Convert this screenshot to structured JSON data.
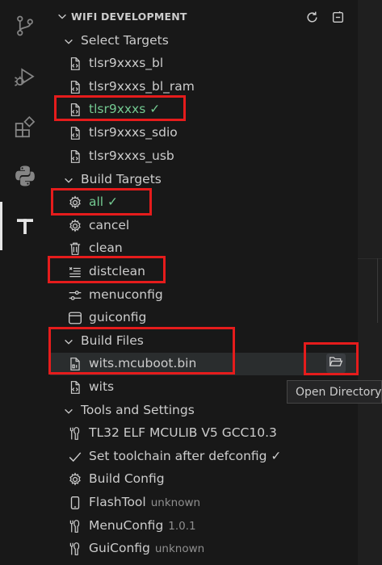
{
  "activity_bar": {
    "icons": [
      "source-control-icon",
      "run-debug-icon",
      "extensions-icon",
      "python-icon",
      "tlsr-tool-icon"
    ]
  },
  "header": {
    "title": "WIFI DEVELOPMENT",
    "actions": [
      "refresh-icon",
      "collapse-all-icon"
    ]
  },
  "tree": {
    "select_targets": {
      "label": "Select Targets",
      "items": [
        {
          "label": "tlsr9xxxs_bl"
        },
        {
          "label": "tlsr9xxxs_bl_ram"
        },
        {
          "label": "tlsr9xxxs ✓",
          "active": true
        },
        {
          "label": "tlsr9xxxs_sdio"
        },
        {
          "label": "tlsr9xxxs_usb"
        }
      ]
    },
    "build_targets": {
      "label": "Build Targets",
      "items": [
        {
          "label": "all ✓",
          "icon": "gear-icon",
          "active": true
        },
        {
          "label": "cancel",
          "icon": "gear-icon"
        },
        {
          "label": "clean",
          "icon": "trash-icon"
        },
        {
          "label": "distclean",
          "icon": "clear-all-icon"
        },
        {
          "label": "menuconfig",
          "icon": "settings-sliders-icon"
        },
        {
          "label": "guiconfig",
          "icon": "window-icon"
        }
      ]
    },
    "build_files": {
      "label": "Build Files",
      "items": [
        {
          "label": "wits.mcuboot.bin",
          "icon": "binary-file-icon"
        },
        {
          "label": "wits",
          "icon": "code-file-icon"
        }
      ]
    },
    "tools": {
      "label": "Tools and Settings",
      "items": [
        {
          "label": "TL32 ELF MCULIB V5 GCC10.3",
          "icon": "tools-icon",
          "desc": ""
        },
        {
          "label": "Set toolchain after defconfig ✓",
          "icon": "check-icon",
          "desc": ""
        },
        {
          "label": "Build Config",
          "icon": "gear-icon",
          "desc": ""
        },
        {
          "label": "FlashTool",
          "icon": "device-icon",
          "desc": "unknown"
        },
        {
          "label": "MenuConfig",
          "icon": "tools-icon",
          "desc": "1.0.1"
        },
        {
          "label": "GuiConfig",
          "icon": "tools-icon",
          "desc": "unknown"
        }
      ]
    }
  },
  "inline_action": {
    "icon": "open-folder-icon"
  },
  "tooltip": {
    "text": "Open Directory"
  },
  "colors": {
    "accent_green": "#73c991",
    "callout_red": "#e51c1c",
    "bg": "#181818"
  }
}
